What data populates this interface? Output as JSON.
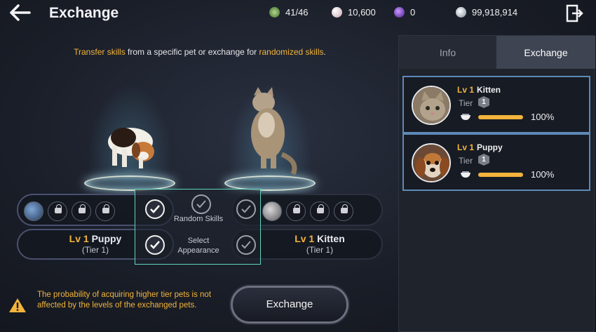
{
  "header": {
    "title": "Exchange",
    "resources": [
      {
        "icon": "pet-slots-icon",
        "value": "41/46",
        "color": "#5c9a4a"
      },
      {
        "icon": "pearl-icon",
        "value": "10,600",
        "color": "#d8c6cc"
      },
      {
        "icon": "purple-gem-icon",
        "value": "0",
        "color": "#7b45c8"
      },
      {
        "icon": "silver-coin-icon",
        "value": "99,918,914",
        "color": "#c8d2dc"
      }
    ]
  },
  "subtitle": {
    "part1": "Transfer skills",
    "part2": " from a specific pet or exchange for ",
    "part3": "randomized skills",
    "part4": "."
  },
  "left_pet": {
    "lv": "Lv 1",
    "name": "Puppy",
    "tier": "(Tier 1)"
  },
  "right_pet": {
    "lv": "Lv 1",
    "name": "Kitten",
    "tier": "(Tier 1)"
  },
  "options": {
    "random_skills": "Random Skills",
    "select_appearance_1": "Select",
    "select_appearance_2": "Appearance"
  },
  "warning": "The probability of acquiring higher tier pets is not affected by the levels of the exchanged pets.",
  "exchange_button": "Exchange",
  "side_panel": {
    "tabs": [
      {
        "label": "Info"
      },
      {
        "label": "Exchange"
      }
    ],
    "active_tab": "Exchange",
    "pets": [
      {
        "lv": "Lv 1",
        "name": "Kitten",
        "tier_label": "Tier",
        "tier": "1",
        "percent": "100%",
        "fill": 1.0
      },
      {
        "lv": "Lv 1",
        "name": "Puppy",
        "tier_label": "Tier",
        "tier": "1",
        "percent": "100%",
        "fill": 1.0
      }
    ]
  },
  "colors": {
    "accent": "#f2b43c",
    "selection": "#5fd6c0",
    "card_border": "#5d8ab8"
  }
}
